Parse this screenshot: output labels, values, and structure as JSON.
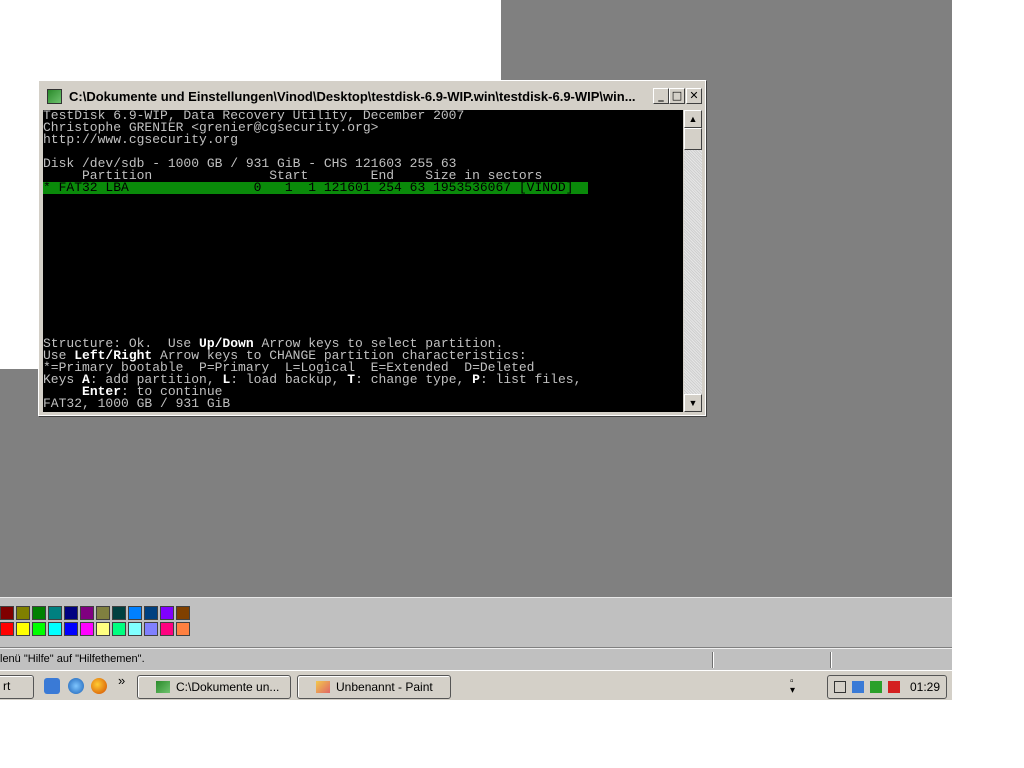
{
  "window": {
    "title": "C:\\Dokumente und Einstellungen\\Vinod\\Desktop\\testdisk-6.9-WIP.win\\testdisk-6.9-WIP\\win...",
    "minimize_label": "_",
    "maximize_label": "□",
    "close_label": "✕"
  },
  "console": {
    "lines": [
      "TestDisk 6.9-WIP, Data Recovery Utility, December 2007",
      "Christophe GRENIER <grenier@cgsecurity.org>",
      "http://www.cgsecurity.org",
      "",
      "Disk /dev/sdb - 1000 GB / 931 GiB - CHS 121603 255 63",
      "     Partition               Start        End    Size in sectors"
    ],
    "selected_row": "* FAT32 LBA                0   1  1 121601 254 63 1953536067 [VINOD]",
    "footer": {
      "l1_a": "Structure: Ok.  Use ",
      "l1_b": "Up/Down",
      "l1_c": " Arrow keys to select partition.",
      "l2_a": "Use ",
      "l2_b": "Left/Right",
      "l2_c": " Arrow keys to CHANGE partition characteristics:",
      "l3": "*=Primary bootable  P=Primary  L=Logical  E=Extended  D=Deleted",
      "l4_a": "Keys ",
      "l4_b": "A",
      "l4_c": ": add partition, ",
      "l4_d": "L",
      "l4_e": ": load backup, ",
      "l4_f": "T",
      "l4_g": ": change type, ",
      "l4_h": "P",
      "l4_i": ": list files,",
      "l5_a": "     ",
      "l5_b": "Enter",
      "l5_c": ": to continue",
      "l6": "FAT32, 1000 GB / 931 GiB"
    }
  },
  "palette": {
    "colors_top": [
      "#800000",
      "#808000",
      "#008000",
      "#008080",
      "#000080",
      "#800080",
      "#808040",
      "#004040",
      "#0080ff",
      "#004080",
      "#8000ff",
      "#804000"
    ],
    "colors_bottom": [
      "#ff0000",
      "#ffff00",
      "#00ff00",
      "#00ffff",
      "#0000ff",
      "#ff00ff",
      "#ffff80",
      "#00ff80",
      "#80ffff",
      "#8080ff",
      "#ff0080",
      "#ff8040"
    ]
  },
  "statusbar": {
    "text": "lenü \"Hilfe\" auf \"Hilfethemen\"."
  },
  "taskbar": {
    "start_label": "rt",
    "chevron": "»",
    "tasks": [
      {
        "label": "C:\\Dokumente un..."
      },
      {
        "label": "Unbenannt - Paint"
      }
    ],
    "clock": "01:29"
  }
}
